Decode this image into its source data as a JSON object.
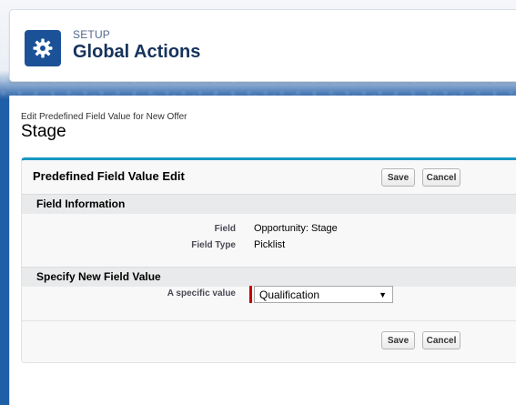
{
  "header": {
    "setup_label": "SETUP",
    "title": "Global Actions",
    "icon": "gear-icon"
  },
  "main": {
    "sub_label": "Edit Predefined Field Value for New Offer",
    "record_title": "Stage"
  },
  "panel": {
    "title": "Predefined Field Value Edit",
    "save_label": "Save",
    "cancel_label": "Cancel"
  },
  "field_info": {
    "section_title": "Field Information",
    "field_label": "Field",
    "field_value": "Opportunity: Stage",
    "type_label": "Field Type",
    "type_value": "Picklist"
  },
  "new_value": {
    "section_title": "Specify New Field Value",
    "specific_label": "A specific value",
    "selected": "Qualification"
  },
  "footer": {
    "save_label": "Save",
    "cancel_label": "Cancel"
  },
  "colors": {
    "accent": "#1797c0",
    "icon_bg": "#1b5297",
    "required": "#c00000"
  }
}
